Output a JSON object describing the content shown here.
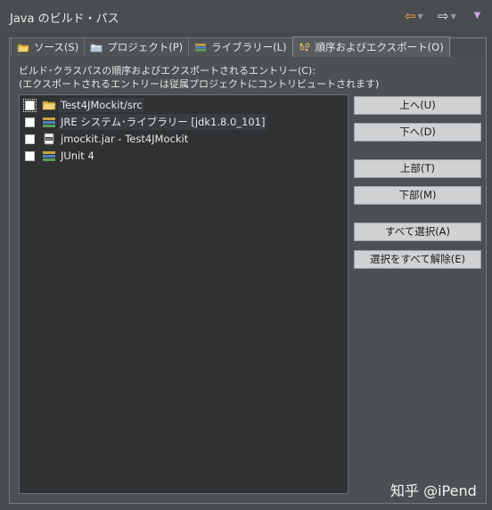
{
  "window": {
    "title": "Java のビルド・パス"
  },
  "nav": {
    "back_icon": "back-arrow-icon",
    "forward_icon": "forward-arrow-icon",
    "menu_icon": "view-menu-icon"
  },
  "tabs": [
    {
      "label": "ソース(S)",
      "icon": "source-folder-icon"
    },
    {
      "label": "プロジェクト(P)",
      "icon": "project-folder-icon"
    },
    {
      "label": "ライブラリー(L)",
      "icon": "library-icon"
    },
    {
      "label": "順序およびエクスポート(O)",
      "icon": "order-export-icon",
      "active": true
    }
  ],
  "description": {
    "line1": "ビルド･クラスパスの順序およびエクスポートされるエントリー(C):",
    "line2": "(エクスポートされるエントリーは従属プロジェクトにコントリビュートされます)"
  },
  "entries": [
    {
      "label": "Test4JMockit/src",
      "icon": "source-folder-icon",
      "checked": false
    },
    {
      "label": "JRE システム･ライブラリー [jdk1.8.0_101]",
      "icon": "library-icon",
      "checked": false
    },
    {
      "label": "jmockit.jar - Test4JMockit",
      "icon": "jar-icon",
      "checked": false
    },
    {
      "label": "JUnit 4",
      "icon": "library-icon",
      "checked": false
    }
  ],
  "buttons": {
    "up": "上へ(U)",
    "down": "下へ(D)",
    "top": "上部(T)",
    "bottom": "下部(M)",
    "select_all": "すべて選択(A)",
    "deselect_all": "選択をすべて解除(E)"
  },
  "watermark": "知乎 @iPend"
}
